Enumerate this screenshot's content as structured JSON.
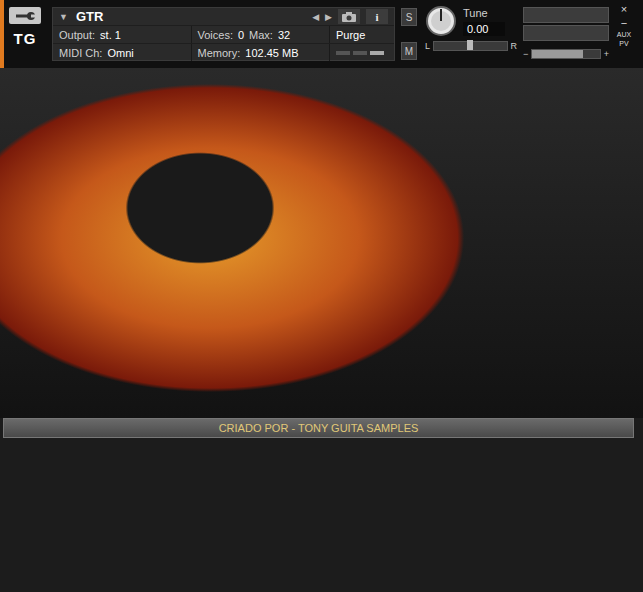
{
  "logo": {
    "text": "TG"
  },
  "instrument": {
    "collapse": "▼",
    "name": "GTR",
    "prev": "◀",
    "next": "▶",
    "info": "i"
  },
  "output": {
    "label": "Output:",
    "value": "st. 1"
  },
  "voices": {
    "label": "Voices:",
    "value": "0",
    "max_label": "Max:",
    "max": "32"
  },
  "purge": {
    "label": "Purge"
  },
  "midi": {
    "label": "MIDI Ch:",
    "value": "Omni"
  },
  "memory": {
    "label": "Memory:",
    "value": "102.45 MB"
  },
  "solo": {
    "label": "S"
  },
  "mute": {
    "label": "M"
  },
  "tune": {
    "label": "Tune",
    "value": "0.00",
    "level": 0.5
  },
  "pan": {
    "left": "L",
    "right": "R",
    "level": 0.5
  },
  "meters": [
    {
      "level": 0
    },
    {
      "level": 0
    }
  ],
  "volume": {
    "minus": "−",
    "plus": "+",
    "level": 0.75
  },
  "window_buttons": [
    "×",
    "−",
    "AUX",
    "PV"
  ],
  "footer": {
    "credit": "CRIADO POR - TONY GUITA SAMPLES"
  }
}
